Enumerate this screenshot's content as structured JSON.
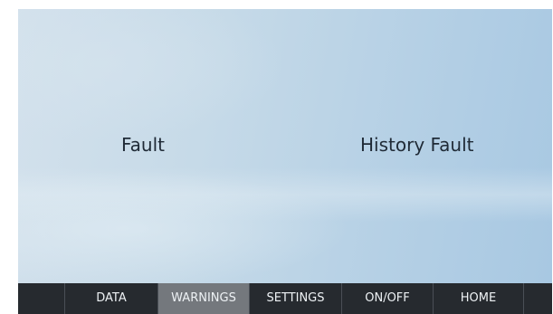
{
  "warnings_screen": {
    "options": {
      "fault_label": "Fault",
      "history_fault_label": "History Fault"
    }
  },
  "navbar": {
    "items": [
      {
        "label": "DATA",
        "active": false
      },
      {
        "label": "WARNINGS",
        "active": true
      },
      {
        "label": "SETTINGS",
        "active": false
      },
      {
        "label": "ON/OFF",
        "active": false
      },
      {
        "label": "HOME",
        "active": false
      }
    ],
    "colors": {
      "background": "#262a2f",
      "active_background": "#74787d",
      "text": "#eef2f5"
    }
  }
}
